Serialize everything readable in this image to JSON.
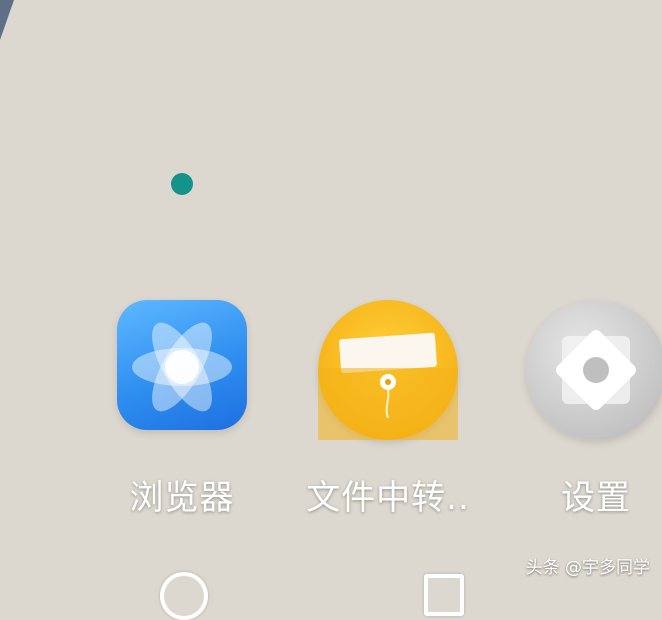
{
  "apps": [
    {
      "label": "浏览器",
      "icon": "browser-atom-icon"
    },
    {
      "label": "文件中转..",
      "icon": "file-transfer-envelope-icon"
    },
    {
      "label": "设置",
      "icon": "settings-gear-icon"
    }
  ],
  "watermark": "头条 @宇多同学",
  "nav": {
    "home": "home-circle-icon",
    "recent": "recent-apps-square-icon"
  },
  "colors": {
    "wallpaper": "#dcd8cf",
    "dot": "#14938a",
    "browser": "#2f8ff0",
    "files": "#f6b418",
    "settings": "#c9c9c9"
  }
}
